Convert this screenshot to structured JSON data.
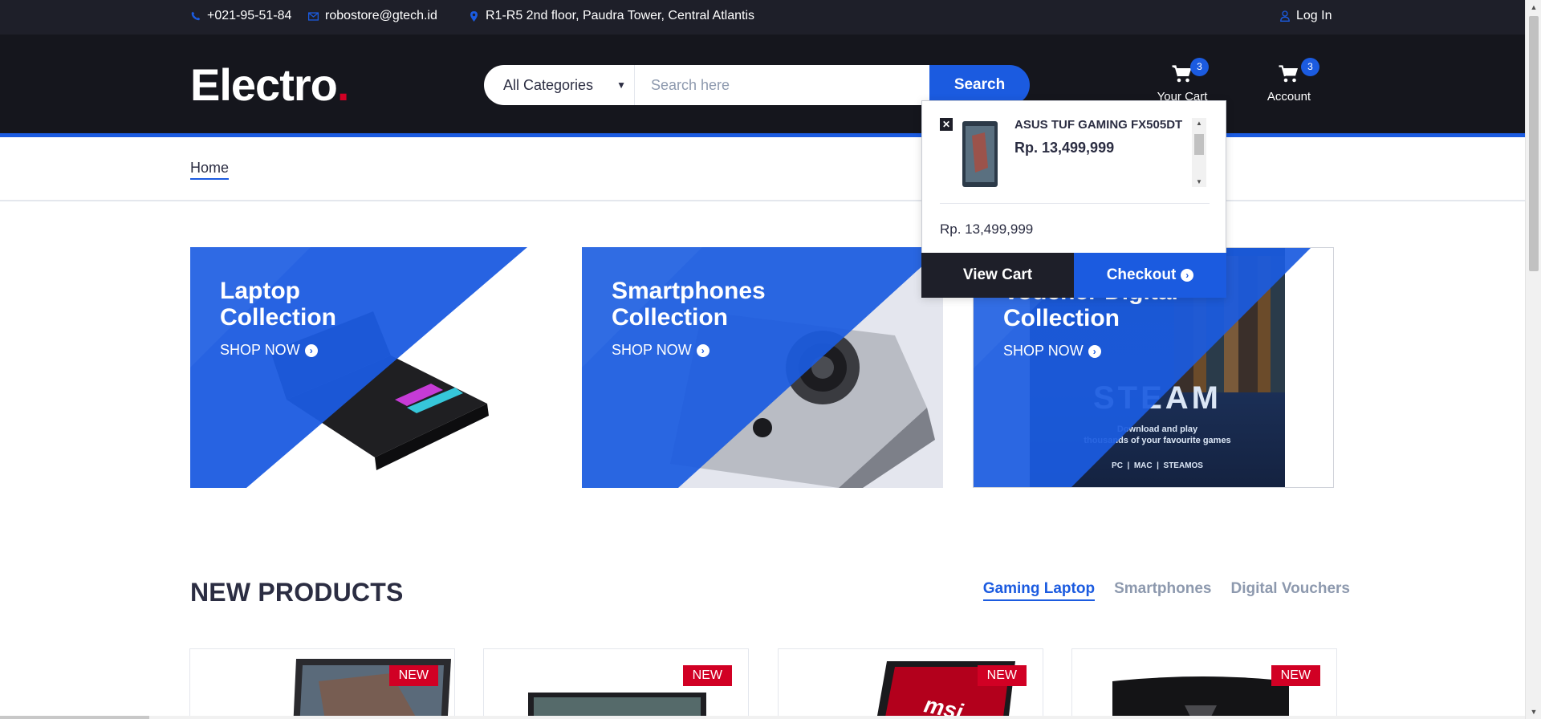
{
  "topbar": {
    "phone": "+021-95-51-84",
    "email": "robostore@gtech.id",
    "address": "R1-R5 2nd floor, Paudra Tower, Central Atlantis",
    "login": "Log In"
  },
  "header": {
    "logo_text": "Electro",
    "logo_dot": ".",
    "category_selected": "All Categories",
    "search_placeholder": "Search here",
    "search_button": "Search",
    "cart_label": "Your Cart",
    "cart_count": "3",
    "account_label": "Account",
    "account_count": "3"
  },
  "breadcrumb": {
    "home": "Home"
  },
  "collections": [
    {
      "title_line1": "Laptop",
      "title_line2": "Collection",
      "cta": "SHOP NOW"
    },
    {
      "title_line1": "Smartphones",
      "title_line2": "Collection",
      "cta": "SHOP NOW"
    },
    {
      "title_line1": "Voucher Digital",
      "title_line2": "Collection",
      "cta": "SHOP NOW",
      "image_text": "STEAM",
      "image_sub1": "Download and play",
      "image_sub2": "thousands of your favourite games",
      "image_platforms": "PC  |  MAC  |  STEAMOS"
    }
  ],
  "new_products": {
    "title": "NEW PRODUCTS",
    "tabs": [
      "Gaming Laptop",
      "Smartphones",
      "Digital Vouchers"
    ],
    "active_tab": "Gaming Laptop",
    "badge": "NEW"
  },
  "cart_dropdown": {
    "item_name": "ASUS TUF GAMING FX505DT",
    "item_price": "Rp. 13,499,999",
    "subtotal": "Rp. 13,499,999",
    "view_cart": "View Cart",
    "checkout": "Checkout"
  },
  "colors": {
    "primary": "#1b5be0",
    "dark": "#15161d",
    "topbar": "#1e1f29",
    "accent_red": "#d10024"
  }
}
